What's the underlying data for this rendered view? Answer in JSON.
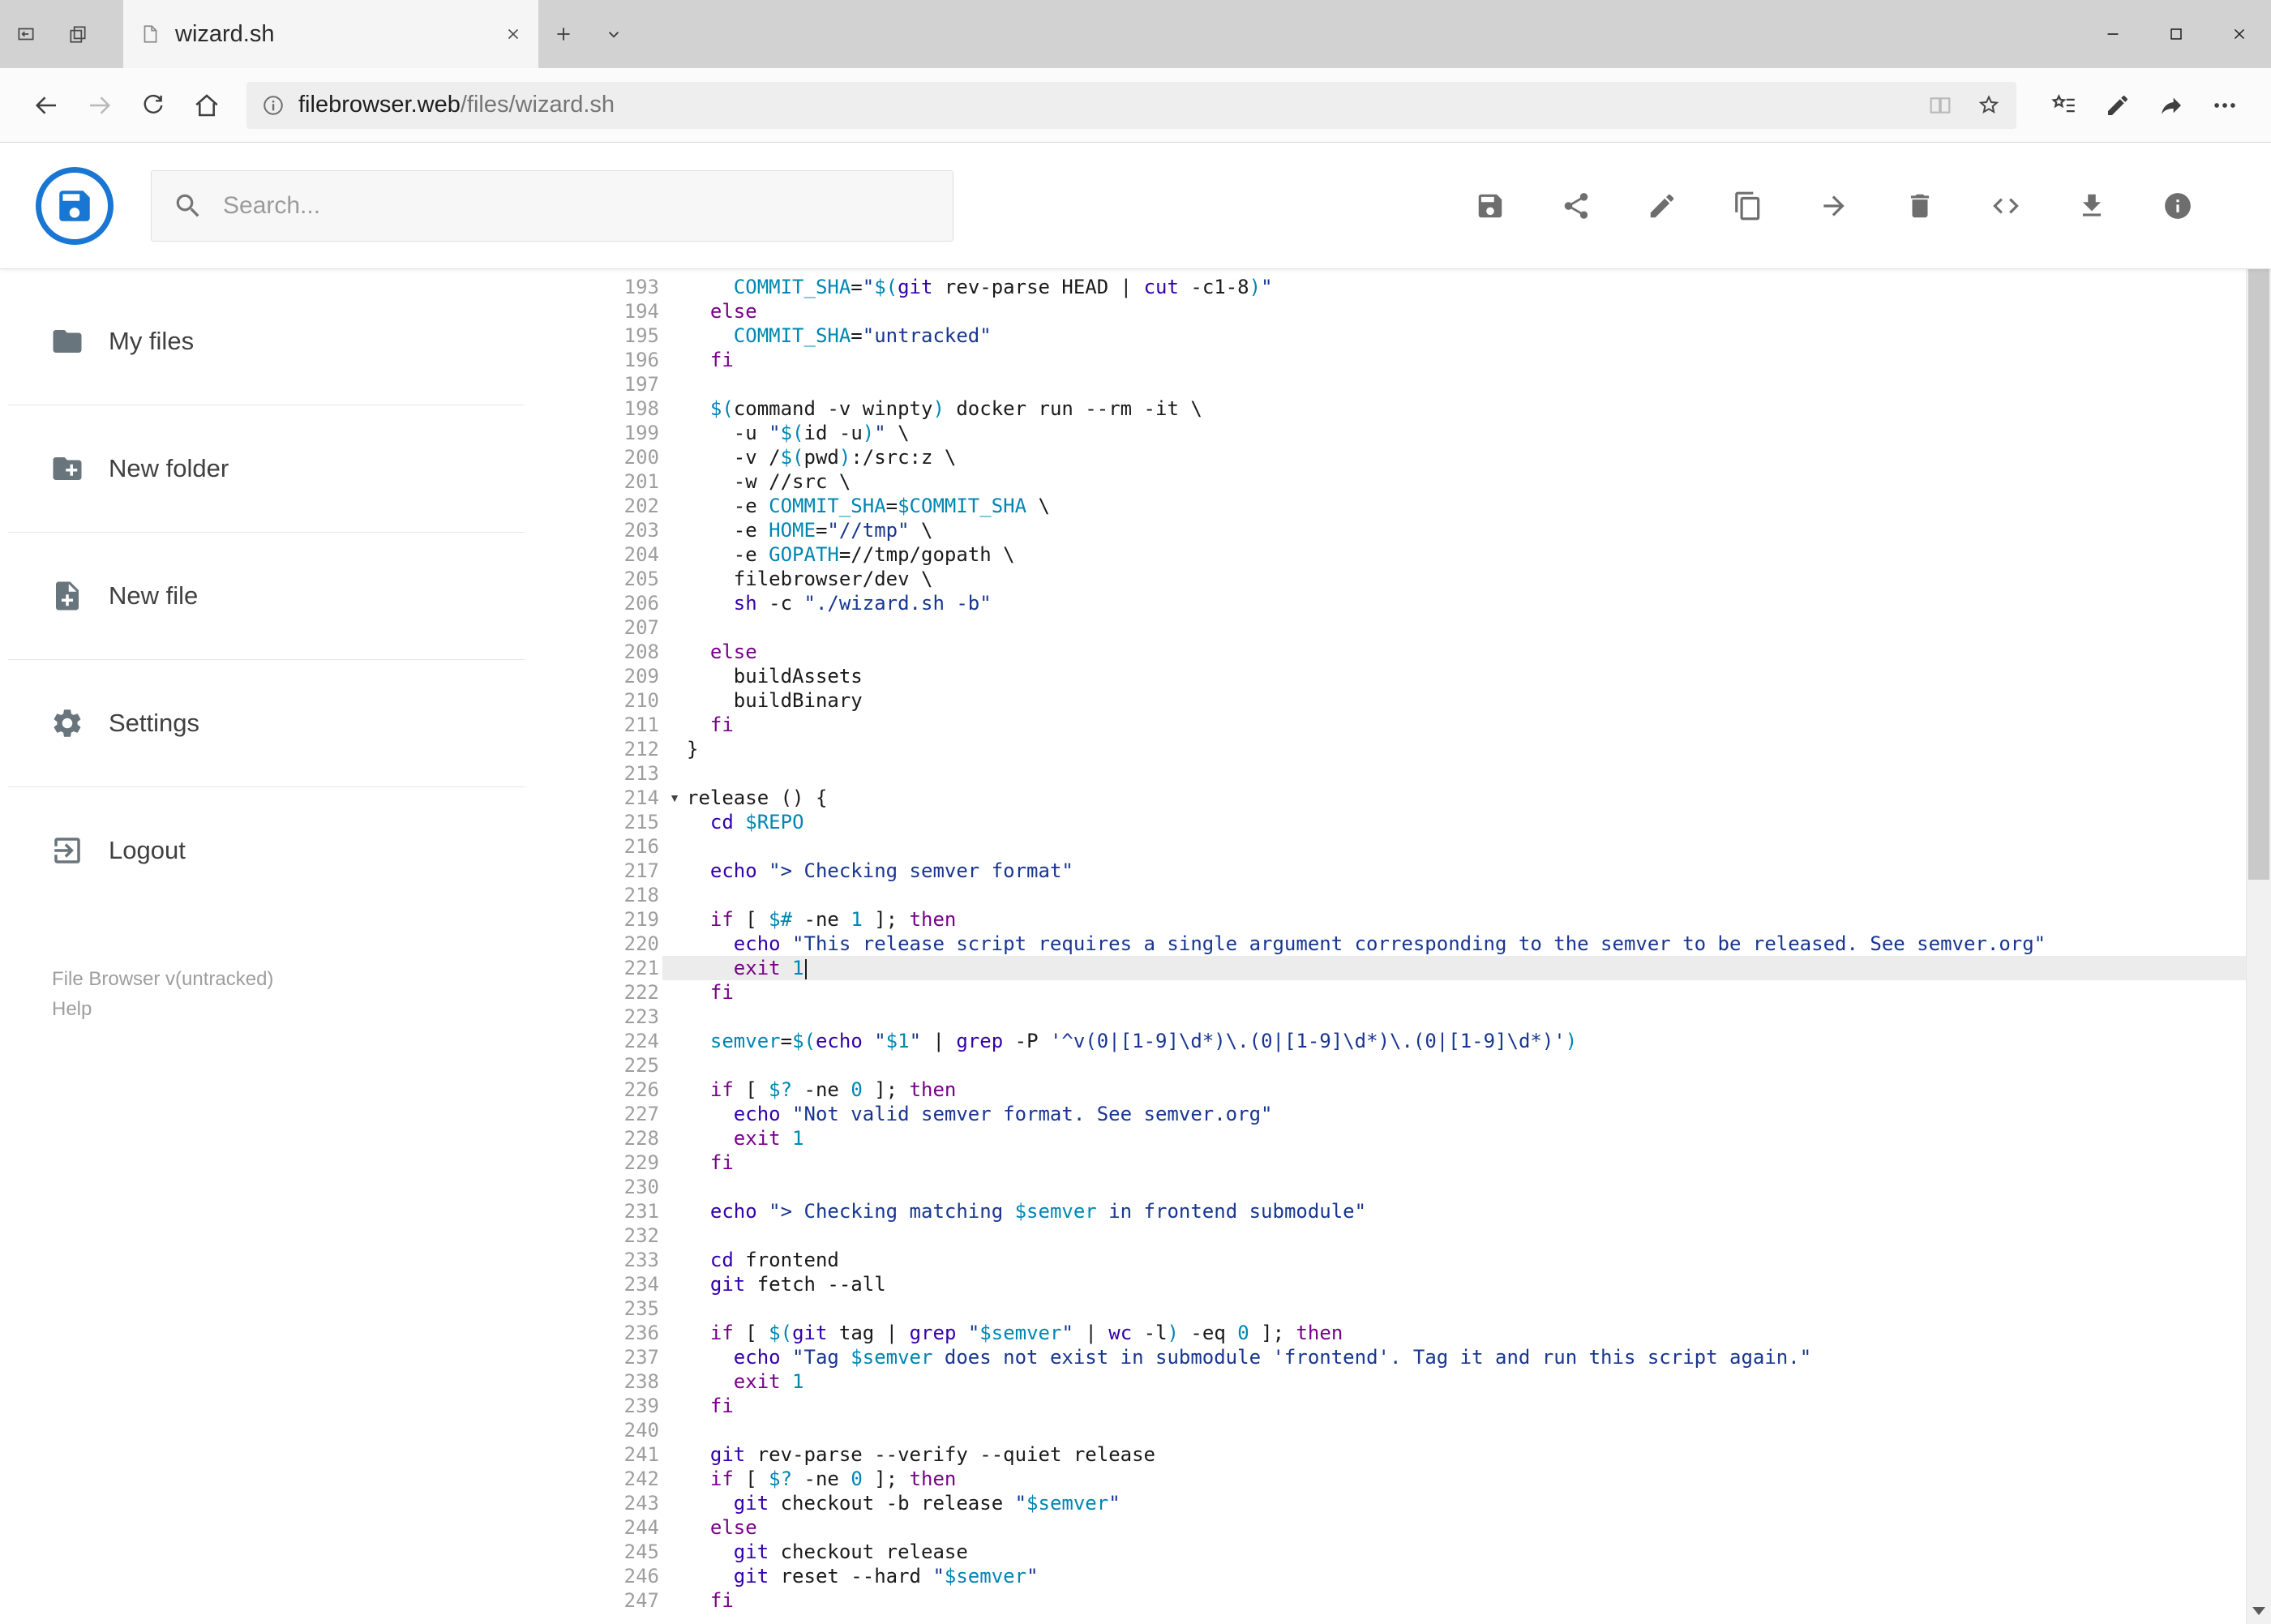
{
  "window": {
    "controls": [
      "minimize",
      "maximize",
      "close"
    ]
  },
  "browser": {
    "tab": {
      "title": "wizard.sh"
    },
    "url": {
      "host": "filebrowser.web",
      "path": "/files/wizard.sh"
    }
  },
  "header": {
    "search_placeholder": "Search...",
    "toolbar_icons": [
      "save",
      "share",
      "rename",
      "copy",
      "move",
      "delete",
      "raw-code",
      "download",
      "info"
    ]
  },
  "sidebar": {
    "items": [
      {
        "label": "My files",
        "icon": "folder"
      },
      {
        "label": "New folder",
        "icon": "create-new-folder"
      },
      {
        "label": "New file",
        "icon": "note-add"
      },
      {
        "label": "Settings",
        "icon": "gear"
      },
      {
        "label": "Logout",
        "icon": "logout"
      }
    ],
    "footer": {
      "version": "File Browser v(untracked)",
      "help": "Help"
    }
  },
  "palette": {
    "accent_blue": "#1976d2",
    "active_line_bg": "#ececec",
    "syntax": {
      "p": "#1a1a1a",
      "k": "#770088",
      "b": "#3300aa",
      "s": "#183691",
      "v": "#0086b3",
      "d": "#0086b3"
    }
  },
  "editor": {
    "active_line": 221,
    "lines": [
      {
        "n": 193,
        "t": [
          [
            "p",
            "    "
          ],
          [
            "v",
            "COMMIT_SHA"
          ],
          [
            "p",
            "="
          ],
          [
            "s",
            "\""
          ],
          [
            "v",
            "$("
          ],
          [
            "b",
            "git"
          ],
          [
            "p",
            " rev-parse HEAD | "
          ],
          [
            "b",
            "cut"
          ],
          [
            "p",
            " -c1-8"
          ],
          [
            "v",
            ")"
          ],
          [
            "s",
            "\""
          ]
        ]
      },
      {
        "n": 194,
        "t": [
          [
            "p",
            "  "
          ],
          [
            "k",
            "else"
          ]
        ]
      },
      {
        "n": 195,
        "t": [
          [
            "p",
            "    "
          ],
          [
            "v",
            "COMMIT_SHA"
          ],
          [
            "p",
            "="
          ],
          [
            "s",
            "\"untracked\""
          ]
        ]
      },
      {
        "n": 196,
        "t": [
          [
            "p",
            "  "
          ],
          [
            "k",
            "fi"
          ]
        ]
      },
      {
        "n": 197,
        "t": []
      },
      {
        "n": 198,
        "t": [
          [
            "p",
            "  "
          ],
          [
            "v",
            "$("
          ],
          [
            "p",
            "command -v winpty"
          ],
          [
            "v",
            ")"
          ],
          [
            "p",
            " docker run --rm -it \\"
          ]
        ]
      },
      {
        "n": 199,
        "t": [
          [
            "p",
            "    -u "
          ],
          [
            "s",
            "\""
          ],
          [
            "v",
            "$("
          ],
          [
            "p",
            "id -u"
          ],
          [
            "v",
            ")"
          ],
          [
            "s",
            "\""
          ],
          [
            "p",
            " \\"
          ]
        ]
      },
      {
        "n": 200,
        "t": [
          [
            "p",
            "    -v /"
          ],
          [
            "v",
            "$("
          ],
          [
            "p",
            "pwd"
          ],
          [
            "v",
            ")"
          ],
          [
            "p",
            ":/src:z \\"
          ]
        ]
      },
      {
        "n": 201,
        "t": [
          [
            "p",
            "    -w //src \\"
          ]
        ]
      },
      {
        "n": 202,
        "t": [
          [
            "p",
            "    -e "
          ],
          [
            "v",
            "COMMIT_SHA"
          ],
          [
            "p",
            "="
          ],
          [
            "v",
            "$COMMIT_SHA"
          ],
          [
            "p",
            " \\"
          ]
        ]
      },
      {
        "n": 203,
        "t": [
          [
            "p",
            "    -e "
          ],
          [
            "v",
            "HOME"
          ],
          [
            "p",
            "="
          ],
          [
            "s",
            "\"//tmp\""
          ],
          [
            "p",
            " \\"
          ]
        ]
      },
      {
        "n": 204,
        "t": [
          [
            "p",
            "    -e "
          ],
          [
            "v",
            "GOPATH"
          ],
          [
            "p",
            "=//tmp/gopath \\"
          ]
        ]
      },
      {
        "n": 205,
        "t": [
          [
            "p",
            "    filebrowser/dev \\"
          ]
        ]
      },
      {
        "n": 206,
        "t": [
          [
            "p",
            "    "
          ],
          [
            "b",
            "sh"
          ],
          [
            "p",
            " -c "
          ],
          [
            "s",
            "\"./wizard.sh -b\""
          ]
        ]
      },
      {
        "n": 207,
        "t": []
      },
      {
        "n": 208,
        "t": [
          [
            "p",
            "  "
          ],
          [
            "k",
            "else"
          ]
        ]
      },
      {
        "n": 209,
        "t": [
          [
            "p",
            "    buildAssets"
          ]
        ]
      },
      {
        "n": 210,
        "t": [
          [
            "p",
            "    buildBinary"
          ]
        ]
      },
      {
        "n": 211,
        "t": [
          [
            "p",
            "  "
          ],
          [
            "k",
            "fi"
          ]
        ]
      },
      {
        "n": 212,
        "t": [
          [
            "p",
            "}"
          ]
        ]
      },
      {
        "n": 213,
        "t": []
      },
      {
        "n": 214,
        "fold": true,
        "t": [
          [
            "p",
            "release () {"
          ]
        ]
      },
      {
        "n": 215,
        "t": [
          [
            "p",
            "  "
          ],
          [
            "b",
            "cd"
          ],
          [
            "p",
            " "
          ],
          [
            "v",
            "$REPO"
          ]
        ]
      },
      {
        "n": 216,
        "t": []
      },
      {
        "n": 217,
        "t": [
          [
            "p",
            "  "
          ],
          [
            "b",
            "echo"
          ],
          [
            "p",
            " "
          ],
          [
            "s",
            "\"> Checking semver format\""
          ]
        ]
      },
      {
        "n": 218,
        "t": []
      },
      {
        "n": 219,
        "t": [
          [
            "p",
            "  "
          ],
          [
            "k",
            "if"
          ],
          [
            "p",
            " [ "
          ],
          [
            "v",
            "$#"
          ],
          [
            "p",
            " -ne "
          ],
          [
            "d",
            "1"
          ],
          [
            "p",
            " ]; "
          ],
          [
            "k",
            "then"
          ]
        ]
      },
      {
        "n": 220,
        "t": [
          [
            "p",
            "    "
          ],
          [
            "b",
            "echo"
          ],
          [
            "p",
            " "
          ],
          [
            "s",
            "\"This release script requires a single argument corresponding to the semver to be released. See semver.org\""
          ]
        ]
      },
      {
        "n": 221,
        "active": true,
        "cursor": true,
        "t": [
          [
            "p",
            "    "
          ],
          [
            "k",
            "exit"
          ],
          [
            "p",
            " "
          ],
          [
            "d",
            "1"
          ]
        ]
      },
      {
        "n": 222,
        "t": [
          [
            "p",
            "  "
          ],
          [
            "k",
            "fi"
          ]
        ]
      },
      {
        "n": 223,
        "t": []
      },
      {
        "n": 224,
        "t": [
          [
            "p",
            "  "
          ],
          [
            "v",
            "semver"
          ],
          [
            "p",
            "="
          ],
          [
            "v",
            "$("
          ],
          [
            "b",
            "echo"
          ],
          [
            "p",
            " "
          ],
          [
            "s",
            "\""
          ],
          [
            "v",
            "$1"
          ],
          [
            "s",
            "\""
          ],
          [
            "p",
            " | "
          ],
          [
            "b",
            "grep"
          ],
          [
            "p",
            " -P "
          ],
          [
            "s",
            "'^v(0|[1-9]\\d*)\\.(0|[1-9]\\d*)\\.(0|[1-9]\\d*)'"
          ],
          [
            "v",
            ")"
          ]
        ]
      },
      {
        "n": 225,
        "t": []
      },
      {
        "n": 226,
        "t": [
          [
            "p",
            "  "
          ],
          [
            "k",
            "if"
          ],
          [
            "p",
            " [ "
          ],
          [
            "v",
            "$?"
          ],
          [
            "p",
            " -ne "
          ],
          [
            "d",
            "0"
          ],
          [
            "p",
            " ]; "
          ],
          [
            "k",
            "then"
          ]
        ]
      },
      {
        "n": 227,
        "t": [
          [
            "p",
            "    "
          ],
          [
            "b",
            "echo"
          ],
          [
            "p",
            " "
          ],
          [
            "s",
            "\"Not valid semver format. See semver.org\""
          ]
        ]
      },
      {
        "n": 228,
        "t": [
          [
            "p",
            "    "
          ],
          [
            "k",
            "exit"
          ],
          [
            "p",
            " "
          ],
          [
            "d",
            "1"
          ]
        ]
      },
      {
        "n": 229,
        "t": [
          [
            "p",
            "  "
          ],
          [
            "k",
            "fi"
          ]
        ]
      },
      {
        "n": 230,
        "t": []
      },
      {
        "n": 231,
        "t": [
          [
            "p",
            "  "
          ],
          [
            "b",
            "echo"
          ],
          [
            "p",
            " "
          ],
          [
            "s",
            "\"> Checking matching "
          ],
          [
            "v",
            "$semver"
          ],
          [
            "s",
            " in frontend submodule\""
          ]
        ]
      },
      {
        "n": 232,
        "t": []
      },
      {
        "n": 233,
        "t": [
          [
            "p",
            "  "
          ],
          [
            "b",
            "cd"
          ],
          [
            "p",
            " frontend"
          ]
        ]
      },
      {
        "n": 234,
        "t": [
          [
            "p",
            "  "
          ],
          [
            "b",
            "git"
          ],
          [
            "p",
            " fetch --all"
          ]
        ]
      },
      {
        "n": 235,
        "t": []
      },
      {
        "n": 236,
        "t": [
          [
            "p",
            "  "
          ],
          [
            "k",
            "if"
          ],
          [
            "p",
            " [ "
          ],
          [
            "v",
            "$("
          ],
          [
            "b",
            "git"
          ],
          [
            "p",
            " tag | "
          ],
          [
            "b",
            "grep"
          ],
          [
            "p",
            " "
          ],
          [
            "s",
            "\""
          ],
          [
            "v",
            "$semver"
          ],
          [
            "s",
            "\""
          ],
          [
            "p",
            " | "
          ],
          [
            "b",
            "wc"
          ],
          [
            "p",
            " -l"
          ],
          [
            "v",
            ")"
          ],
          [
            "p",
            " -eq "
          ],
          [
            "d",
            "0"
          ],
          [
            "p",
            " ]; "
          ],
          [
            "k",
            "then"
          ]
        ]
      },
      {
        "n": 237,
        "t": [
          [
            "p",
            "    "
          ],
          [
            "b",
            "echo"
          ],
          [
            "p",
            " "
          ],
          [
            "s",
            "\"Tag "
          ],
          [
            "v",
            "$semver"
          ],
          [
            "s",
            " does not exist in submodule 'frontend'. Tag it and run this script again.\""
          ]
        ]
      },
      {
        "n": 238,
        "t": [
          [
            "p",
            "    "
          ],
          [
            "k",
            "exit"
          ],
          [
            "p",
            " "
          ],
          [
            "d",
            "1"
          ]
        ]
      },
      {
        "n": 239,
        "t": [
          [
            "p",
            "  "
          ],
          [
            "k",
            "fi"
          ]
        ]
      },
      {
        "n": 240,
        "t": []
      },
      {
        "n": 241,
        "t": [
          [
            "p",
            "  "
          ],
          [
            "b",
            "git"
          ],
          [
            "p",
            " rev-parse --verify --quiet release"
          ]
        ]
      },
      {
        "n": 242,
        "t": [
          [
            "p",
            "  "
          ],
          [
            "k",
            "if"
          ],
          [
            "p",
            " [ "
          ],
          [
            "v",
            "$?"
          ],
          [
            "p",
            " -ne "
          ],
          [
            "d",
            "0"
          ],
          [
            "p",
            " ]; "
          ],
          [
            "k",
            "then"
          ]
        ]
      },
      {
        "n": 243,
        "t": [
          [
            "p",
            "    "
          ],
          [
            "b",
            "git"
          ],
          [
            "p",
            " checkout -b release "
          ],
          [
            "s",
            "\""
          ],
          [
            "v",
            "$semver"
          ],
          [
            "s",
            "\""
          ]
        ]
      },
      {
        "n": 244,
        "t": [
          [
            "p",
            "  "
          ],
          [
            "k",
            "else"
          ]
        ]
      },
      {
        "n": 245,
        "t": [
          [
            "p",
            "    "
          ],
          [
            "b",
            "git"
          ],
          [
            "p",
            " checkout release"
          ]
        ]
      },
      {
        "n": 246,
        "t": [
          [
            "p",
            "    "
          ],
          [
            "b",
            "git"
          ],
          [
            "p",
            " reset --hard "
          ],
          [
            "s",
            "\""
          ],
          [
            "v",
            "$semver"
          ],
          [
            "s",
            "\""
          ]
        ]
      },
      {
        "n": 247,
        "t": [
          [
            "p",
            "  "
          ],
          [
            "k",
            "fi"
          ]
        ]
      }
    ]
  }
}
